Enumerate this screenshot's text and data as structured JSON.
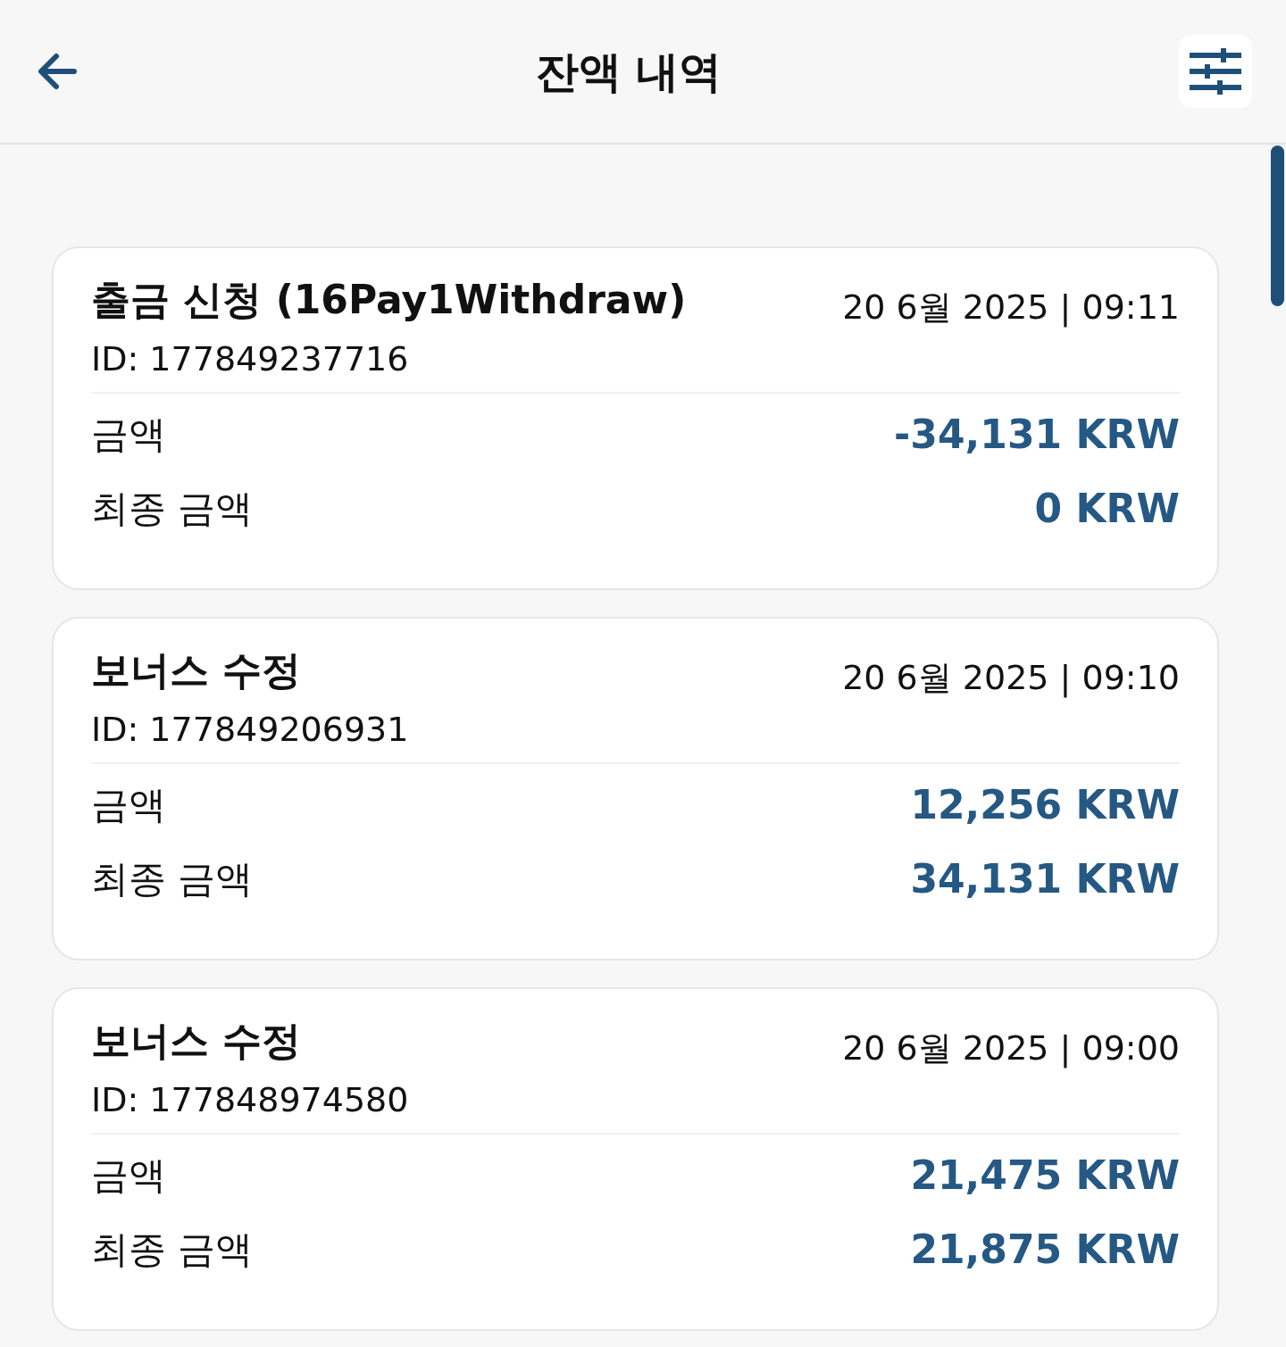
{
  "header": {
    "title": "잔액 내역"
  },
  "transactions": [
    {
      "title": "출금 신청 (16Pay1Withdraw)",
      "datetime": "20 6월 2025 | 09:11",
      "id": "ID: 177849237716",
      "rows": [
        {
          "label": "금액",
          "value": "-34,131 KRW"
        },
        {
          "label": "최종 금액",
          "value": "0 KRW"
        }
      ]
    },
    {
      "title": "보너스 수정",
      "datetime": "20 6월 2025 | 09:10",
      "id": "ID: 177849206931",
      "rows": [
        {
          "label": "금액",
          "value": "12,256 KRW"
        },
        {
          "label": "최종 금액",
          "value": "34,131 KRW"
        }
      ]
    },
    {
      "title": "보너스 수정",
      "datetime": "20 6월 2025 | 09:00",
      "id": "ID: 177848974580",
      "rows": [
        {
          "label": "금액",
          "value": "21,475 KRW"
        },
        {
          "label": "최종 금액",
          "value": "21,875 KRW"
        }
      ]
    }
  ]
}
